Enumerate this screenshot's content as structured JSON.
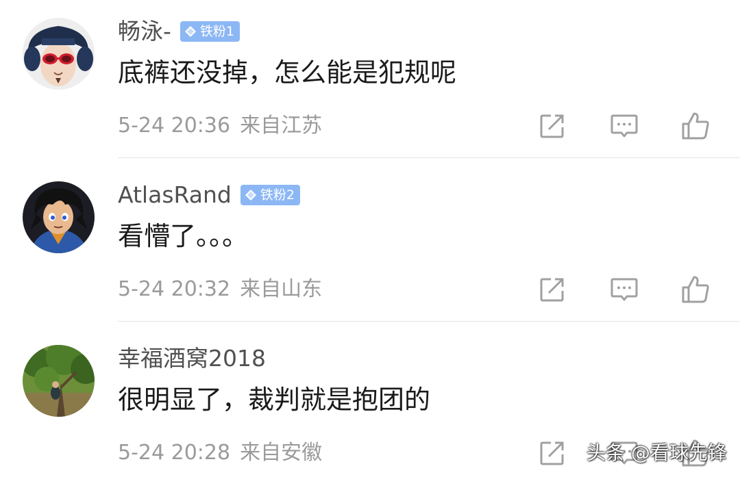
{
  "colors": {
    "username": "#505050",
    "content": "#1a1a1a",
    "meta": "#9a9a9a",
    "badge_bg": "#8cb7f5",
    "divider": "#e4e4e4",
    "icon": "#a0a0a0"
  },
  "comments": [
    {
      "username": "畅泳-",
      "badge": "铁粉1",
      "content": "底裤还没掉，怎么能是犯规呢",
      "date": "5-24 20:36",
      "location": "来自江苏",
      "avatar": "avatar-fur-hat-red-glasses"
    },
    {
      "username": "AtlasRand",
      "badge": "铁粉2",
      "content": "看懵了。。。",
      "date": "5-24 20:32",
      "location": "来自山东",
      "avatar": "avatar-anime-character"
    },
    {
      "username": "幸福酒窝2018",
      "badge": "",
      "content": "很明显了，裁判就是抱团的",
      "date": "5-24 20:28",
      "location": "来自安徽",
      "avatar": "avatar-tree-photo"
    }
  ],
  "actions": {
    "forward_icon": "forward-icon",
    "reply_icon": "reply-icon",
    "like_icon": "thumbs-up-icon"
  },
  "watermark": "头条 @看球先锋"
}
